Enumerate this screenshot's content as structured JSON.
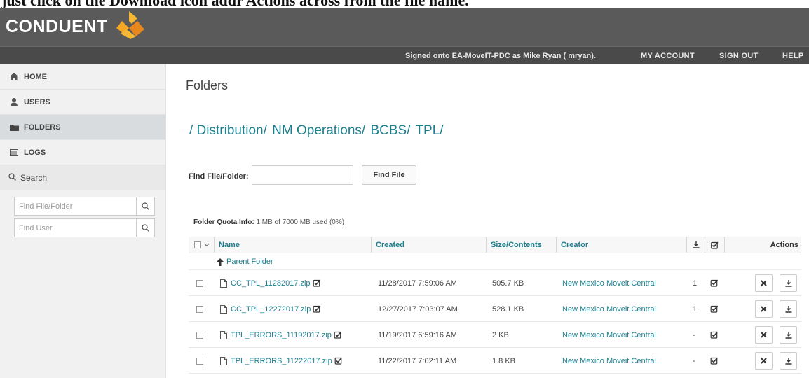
{
  "doc_top_text": "just click on the Download icon            addr Actions across from the file name.",
  "brand": {
    "logo_text": "CONDUENT"
  },
  "userbar": {
    "signed_in": "Signed onto EA-MoveIT-PDC as Mike Ryan ( mryan).",
    "my_account": "MY ACCOUNT",
    "sign_out": "SIGN OUT",
    "help": "HELP"
  },
  "sidebar": {
    "items": [
      {
        "label": "HOME",
        "icon": "home-icon"
      },
      {
        "label": "USERS",
        "icon": "user-icon"
      },
      {
        "label": "FOLDERS",
        "icon": "folder-icon",
        "active": true
      },
      {
        "label": "LOGS",
        "icon": "logs-icon"
      }
    ],
    "search_title": "Search",
    "find_file_placeholder": "Find File/Folder",
    "find_user_placeholder": "Find User"
  },
  "main": {
    "title": "Folders",
    "breadcrumb": [
      "/ Distribution/",
      "NM Operations/",
      "BCBS/",
      "TPL/"
    ],
    "find_label": "Find File/Folder:",
    "find_button": "Find File",
    "quota_label": "Folder Quota Info:",
    "quota_value": "1 MB of 7000 MB used (0%)"
  },
  "table": {
    "headers": {
      "name": "Name",
      "created": "Created",
      "size": "Size/Contents",
      "creator": "Creator",
      "actions": "Actions"
    },
    "parent_folder": "Parent Folder",
    "rows": [
      {
        "name": "CC_TPL_11282017.zip",
        "created": "11/28/2017 7:59:06 AM",
        "size": "505.7 KB",
        "creator": "New Mexico Moveit Central",
        "downloads": "1"
      },
      {
        "name": "CC_TPL_12272017.zip",
        "created": "12/27/2017 7:03:07 AM",
        "size": "528.1 KB",
        "creator": "New Mexico Moveit Central",
        "downloads": "1"
      },
      {
        "name": "TPL_ERRORS_11192017.zip",
        "created": "11/19/2017 6:59:16 AM",
        "size": "2 KB",
        "creator": "New Mexico Moveit Central",
        "downloads": "-"
      },
      {
        "name": "TPL_ERRORS_11222017.zip",
        "created": "11/22/2017 7:02:11 AM",
        "size": "1.8 KB",
        "creator": "New Mexico Moveit Central",
        "downloads": "-"
      }
    ]
  },
  "colors": {
    "accent": "#1a7f8e",
    "header_bg": "#5a5a5a",
    "userbar_bg": "#4a4a4a",
    "logo_orange": "#f5a623"
  }
}
